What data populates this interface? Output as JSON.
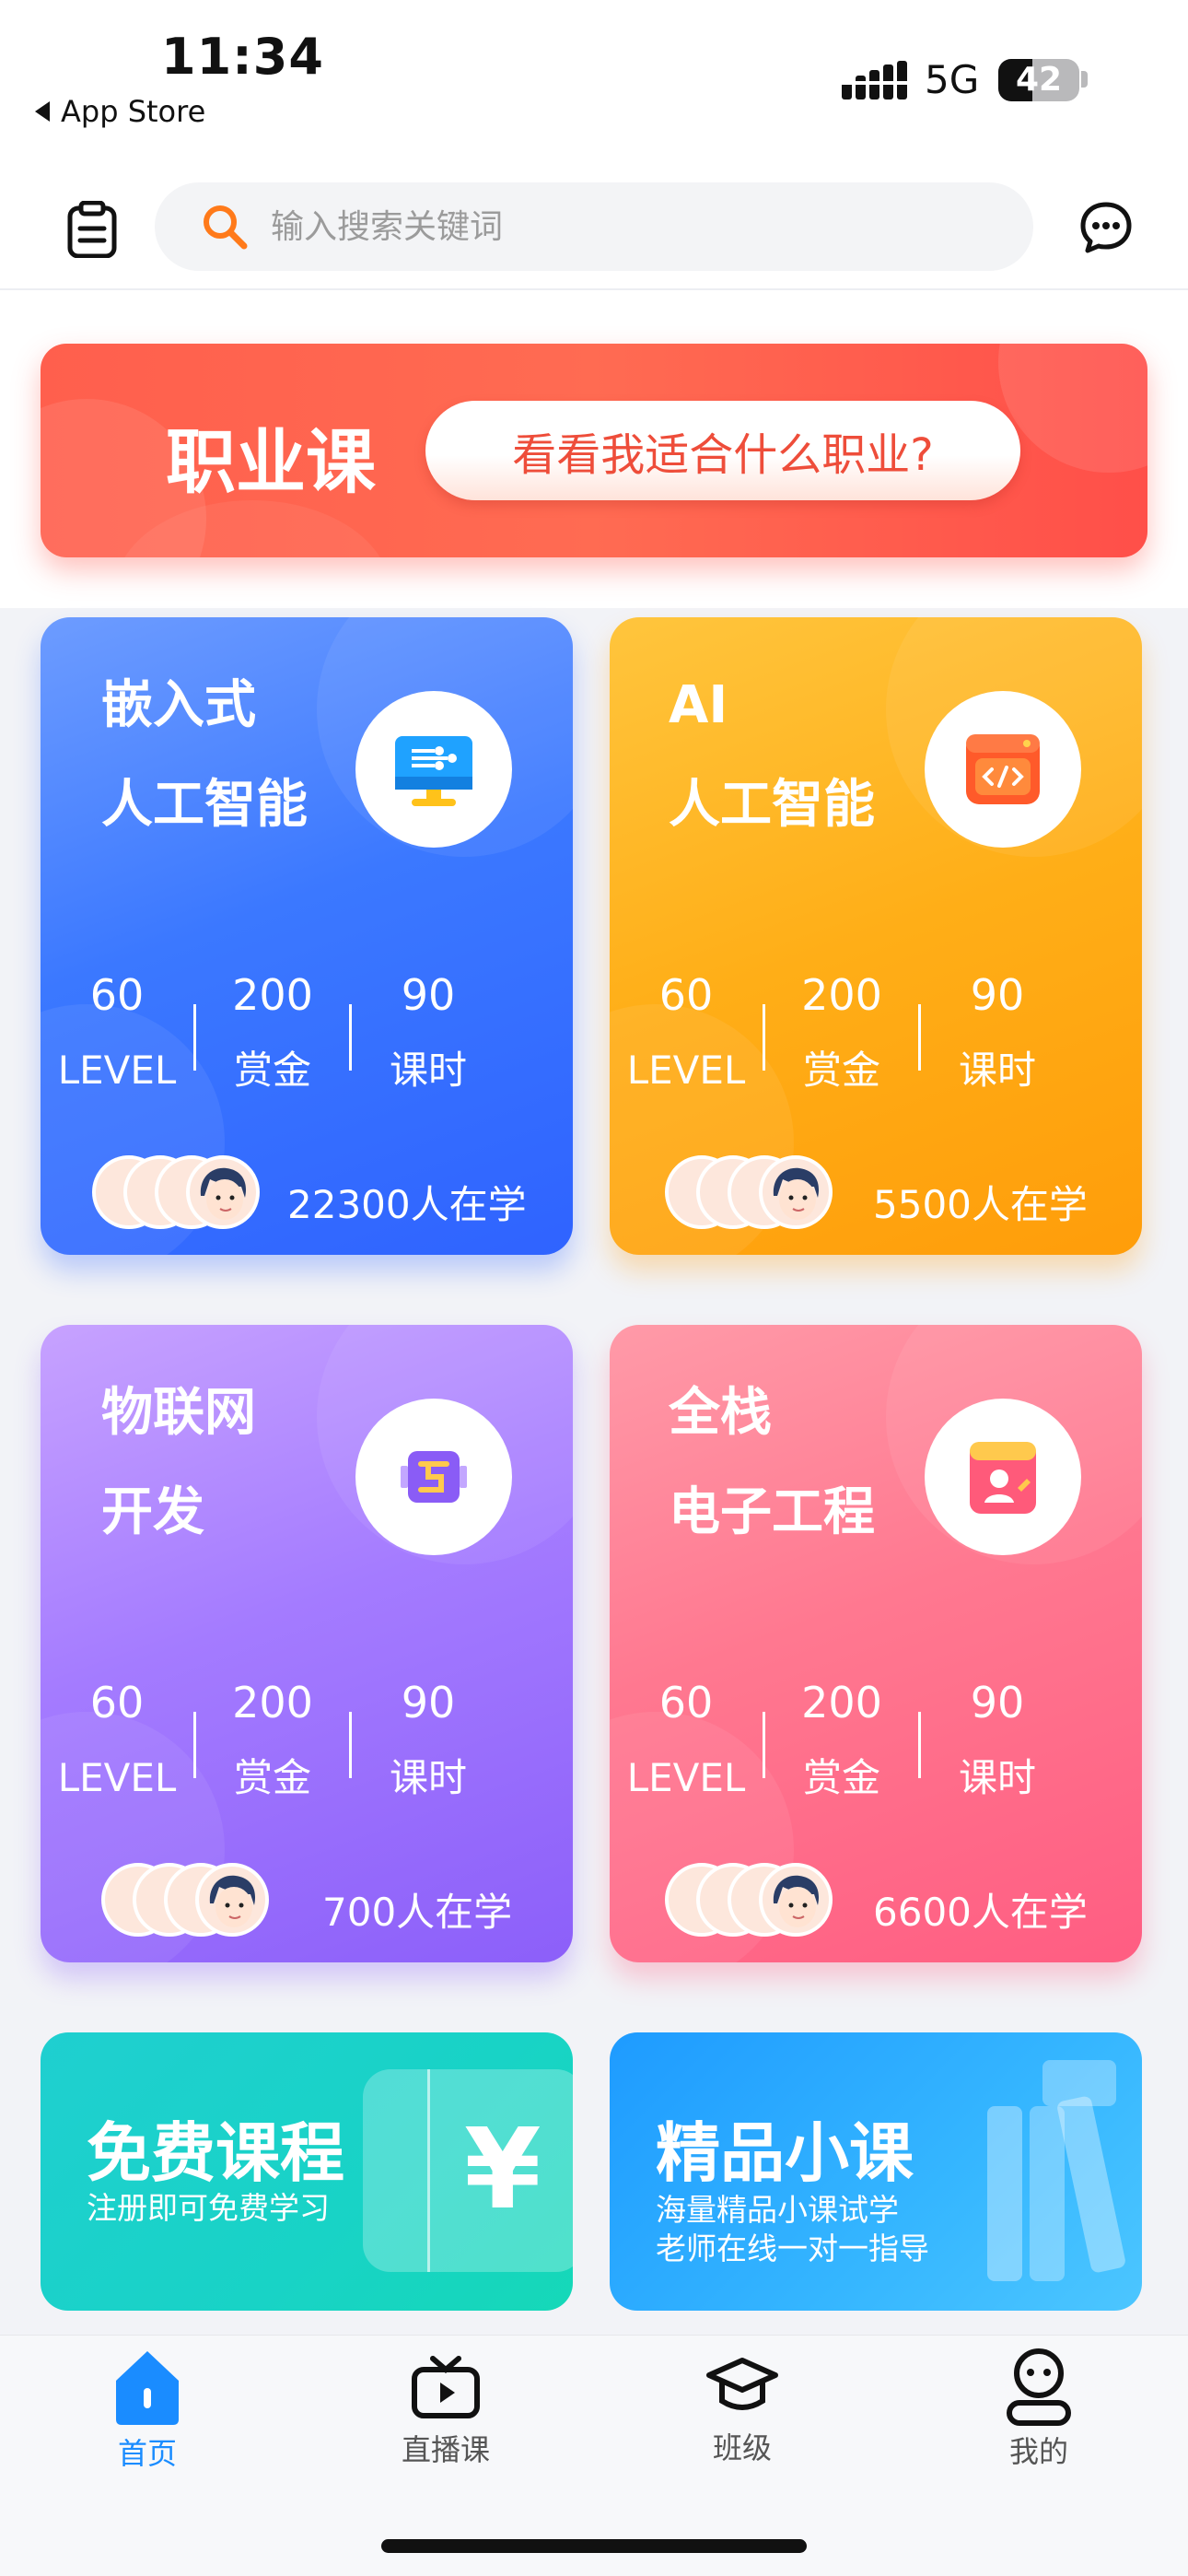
{
  "status_bar": {
    "time": "11:34",
    "back_label": "App Store",
    "network": "5G",
    "battery": "42"
  },
  "header": {
    "search_placeholder": "输入搜索关键词",
    "left_icon": "clipboard-icon",
    "right_icon": "chat-bubble-icon"
  },
  "banner": {
    "title": "职业课",
    "button_label": "看看我适合什么职业?"
  },
  "courses": [
    {
      "title_line1": "嵌入式",
      "title_line2": "人工智能",
      "icon": "monitor-icon",
      "stats": [
        {
          "value": "60",
          "label": "LEVEL"
        },
        {
          "value": "200",
          "label": "赏金"
        },
        {
          "value": "90",
          "label": "课时"
        }
      ],
      "learners": "22300人在学",
      "color": "#3f7bff"
    },
    {
      "title_line1": "AI",
      "title_line2": "人工智能",
      "icon": "code-window-icon",
      "stats": [
        {
          "value": "60",
          "label": "LEVEL"
        },
        {
          "value": "200",
          "label": "赏金"
        },
        {
          "value": "90",
          "label": "课时"
        }
      ],
      "learners": "5500人在学",
      "color": "#ffad14"
    },
    {
      "title_line1": "物联网",
      "title_line2": "开发",
      "icon": "chip-icon",
      "stats": [
        {
          "value": "60",
          "label": "LEVEL"
        },
        {
          "value": "200",
          "label": "赏金"
        },
        {
          "value": "90",
          "label": "课时"
        }
      ],
      "learners": "700人在学",
      "color": "#9a6dfa"
    },
    {
      "title_line1": "全栈",
      "title_line2": "电子工程",
      "icon": "profile-card-icon",
      "stats": [
        {
          "value": "60",
          "label": "LEVEL"
        },
        {
          "value": "200",
          "label": "赏金"
        },
        {
          "value": "90",
          "label": "课时"
        }
      ],
      "learners": "6600人在学",
      "color": "#ff6b8a"
    }
  ],
  "promos": [
    {
      "title": "免费课程",
      "subtitle1": "注册即可免费学习",
      "icon": "yuan-coupon-icon"
    },
    {
      "title": "精品小课",
      "subtitle1": "海量精品小课试学",
      "subtitle2": "老师在线一对一指导",
      "icon": "books-icon"
    }
  ],
  "tabbar": {
    "items": [
      {
        "label": "首页",
        "icon": "home-icon",
        "active": true
      },
      {
        "label": "直播课",
        "icon": "tv-play-icon",
        "active": false
      },
      {
        "label": "班级",
        "icon": "graduation-cap-icon",
        "active": false
      },
      {
        "label": "我的",
        "icon": "user-icon",
        "active": false
      }
    ]
  }
}
